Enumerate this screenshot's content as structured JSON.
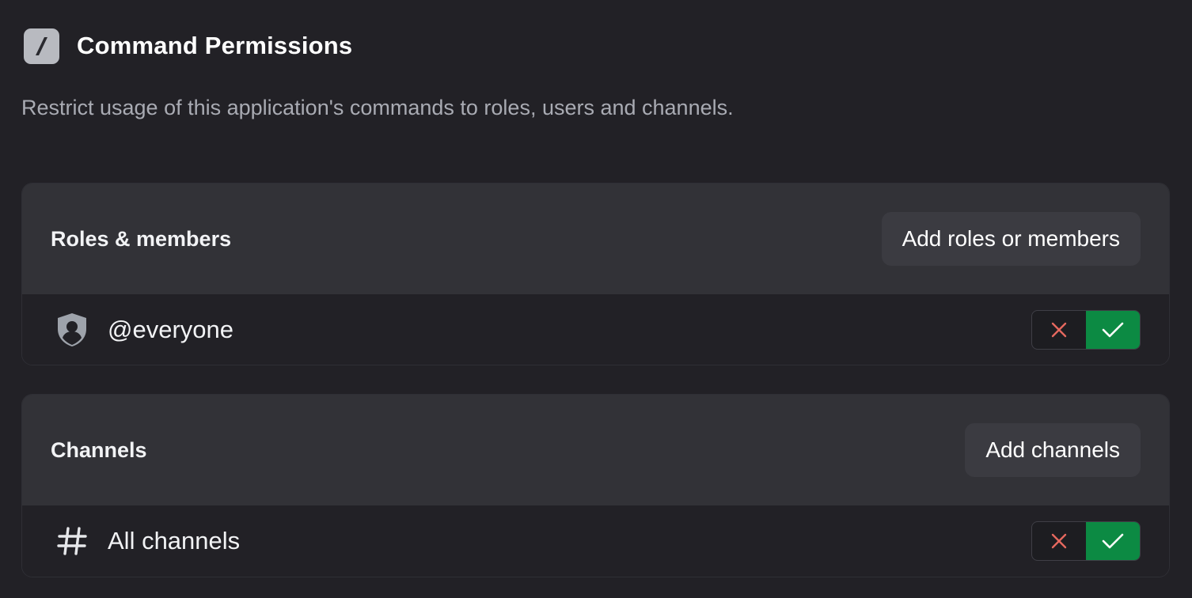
{
  "header": {
    "title": "Command Permissions",
    "icon": "slash-command-icon",
    "description": "Restrict usage of this application's commands to roles, users and channels."
  },
  "roles_section": {
    "title": "Roles & members",
    "add_button_label": "Add roles or members",
    "rows": [
      {
        "icon": "role-shield-icon",
        "label": "@everyone",
        "deny_icon": "x-icon",
        "allow_icon": "check-icon",
        "state": "allowed"
      }
    ]
  },
  "channels_section": {
    "title": "Channels",
    "add_button_label": "Add channels",
    "rows": [
      {
        "icon": "hash-icon",
        "label": "All channels",
        "deny_icon": "x-icon",
        "allow_icon": "check-icon",
        "state": "allowed"
      }
    ]
  },
  "colors": {
    "background": "#222126",
    "card_header": "#323237",
    "allow_active": "#0c8a43",
    "deny_icon": "#e5685f"
  }
}
